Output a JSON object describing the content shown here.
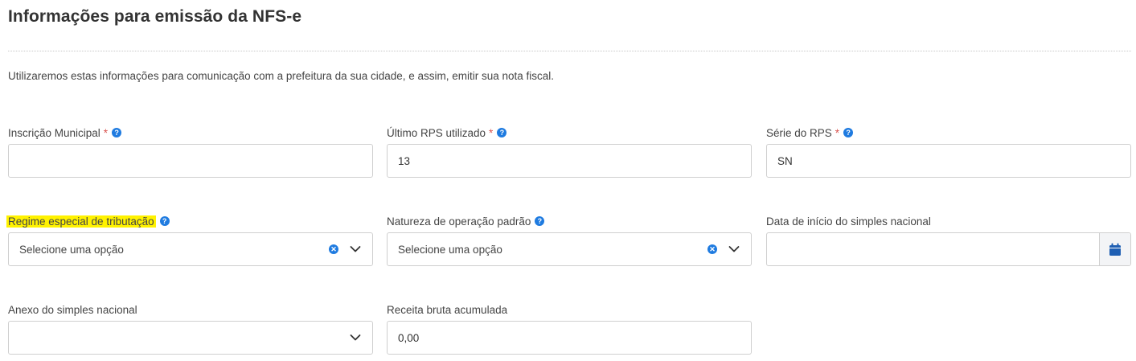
{
  "header": {
    "title": "Informações para emissão da NFS-e",
    "description": "Utilizaremos estas informações para comunicação com a prefeitura da sua cidade, e assim, emitir sua nota fiscal."
  },
  "fields": {
    "inscricao_municipal": {
      "label": "Inscrição Municipal",
      "required_mark": "*",
      "value": ""
    },
    "ultimo_rps": {
      "label": "Último RPS utilizado",
      "required_mark": "*",
      "value": "13"
    },
    "serie_rps": {
      "label": "Série do RPS",
      "required_mark": "*",
      "value": "SN"
    },
    "regime_especial": {
      "label": "Regime especial de tributação",
      "selected": "Selecione uma opção"
    },
    "natureza_operacao": {
      "label": "Natureza de operação padrão",
      "selected": "Selecione uma opção"
    },
    "data_inicio_simples": {
      "label": "Data de início do simples nacional",
      "value": ""
    },
    "anexo_simples": {
      "label": "Anexo do simples nacional",
      "selected": ""
    },
    "receita_bruta": {
      "label": "Receita bruta acumulada",
      "value": "0,00"
    }
  },
  "icons": {
    "help": "question-circle-icon",
    "clear": "clear-circle-icon",
    "chevron": "chevron-down-icon",
    "calendar": "calendar-icon"
  },
  "colors": {
    "accent": "#1f7be0",
    "required": "#d9534f",
    "highlight": "#fff200",
    "calendar_icon": "#1f5fb3"
  }
}
